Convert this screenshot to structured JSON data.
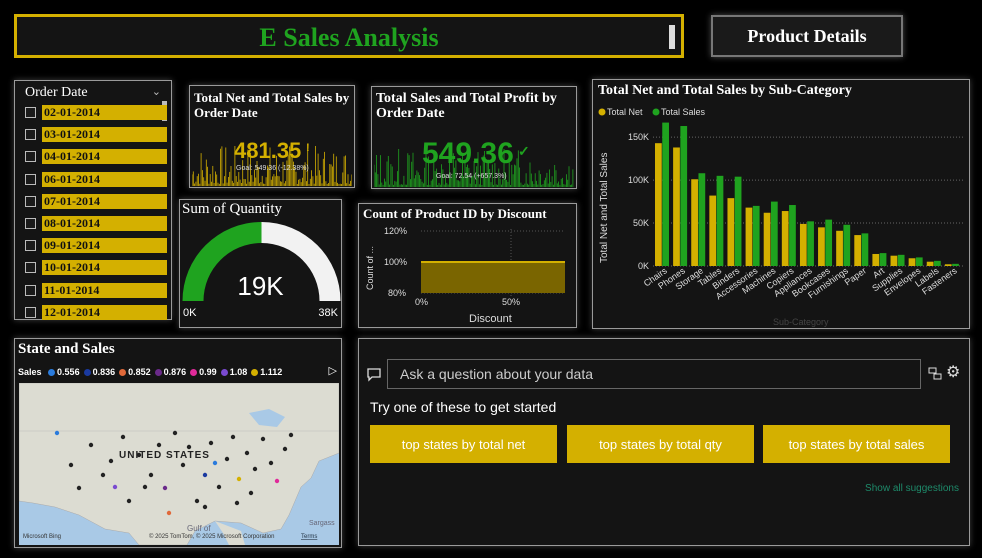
{
  "header": {
    "title": "E Sales Analysis",
    "product_button": "Product Details"
  },
  "slicer": {
    "title": "Order Date",
    "dates": [
      "02-01-2014",
      "03-01-2014",
      "04-01-2014",
      "06-01-2014",
      "07-01-2014",
      "08-01-2014",
      "09-01-2014",
      "10-01-2014",
      "11-01-2014",
      "12-01-2014"
    ]
  },
  "kpi_net": {
    "title": "Total Net and Total Sales by Order Date",
    "value": "481.35",
    "flag": "!",
    "goal": "Goal: 549.36 (-12.38%)"
  },
  "kpi_profit": {
    "title": "Total Sales and Total Profit by Order Date",
    "value": "549.36",
    "goal": "Goal: 72.54 (+657.3%)"
  },
  "gauge": {
    "title": "Sum of Quantity",
    "value": "19K",
    "min": "0K",
    "max": "38K",
    "fill_fraction": 0.5
  },
  "discount_chart": {
    "title": "Count of Product ID by Discount",
    "ylabel": "Count of ...",
    "xlabel": "Discount",
    "yticks": [
      "120%",
      "100%",
      "80%"
    ],
    "xticks": [
      "0%",
      "50%"
    ]
  },
  "subcat_chart": {
    "title": "Total Net and Total Sales by Sub-Category",
    "xlabel": "Sub-Category",
    "ylabel": "Total Net and Total Sales",
    "legend": [
      "Total Net",
      "Total Sales"
    ],
    "yticks": [
      "150K",
      "100K",
      "50K",
      "0K"
    ]
  },
  "chart_data": {
    "type": "bar",
    "categories": [
      "Chairs",
      "Phones",
      "Storage",
      "Tables",
      "Binders",
      "Accessories",
      "Machines",
      "Copiers",
      "Appliances",
      "Bookcases",
      "Furnishings",
      "Paper",
      "Art",
      "Supplies",
      "Envelopes",
      "Labels",
      "Fasteners"
    ],
    "series": [
      {
        "name": "Total Net",
        "values": [
          143000,
          138000,
          101000,
          82000,
          79000,
          68000,
          62000,
          64000,
          49000,
          45000,
          41000,
          36000,
          14000,
          12000,
          9000,
          5000,
          2000
        ]
      },
      {
        "name": "Total Sales",
        "values": [
          167000,
          163000,
          108000,
          105000,
          104000,
          70000,
          75000,
          71000,
          52000,
          54000,
          48000,
          38000,
          15000,
          13000,
          10000,
          6000,
          2500
        ]
      }
    ],
    "ylim": [
      0,
      170000
    ]
  },
  "map": {
    "title": "State and Sales",
    "legend_label": "Sales",
    "legend": [
      {
        "v": "0.556",
        "c": "#2a7bdc"
      },
      {
        "v": "0.836",
        "c": "#1a3aa0"
      },
      {
        "v": "0.852",
        "c": "#e0693a"
      },
      {
        "v": "0.876",
        "c": "#6a2a8a"
      },
      {
        "v": "0.99",
        "c": "#e02a9a"
      },
      {
        "v": "1.08",
        "c": "#7a4ad0"
      },
      {
        "v": "1.112",
        "c": "#d4b000"
      }
    ],
    "country": "UNITED STATES",
    "gulf": "Gulf of",
    "sargasso": "Sargass",
    "credit": "© 2025 TomTom, © 2025 Microsoft Corporation",
    "terms": "Terms",
    "brand": "Microsoft Bing"
  },
  "qa": {
    "placeholder": "Ask a question about your data",
    "prompt": "Try one of these to get started",
    "suggestions": [
      "top states by total net",
      "top states by total qty",
      "top states by total sales"
    ],
    "show_all": "Show all suggestions"
  },
  "colors": {
    "net": "#d4b000",
    "sales": "#1fa31f",
    "bg": "#141414"
  }
}
